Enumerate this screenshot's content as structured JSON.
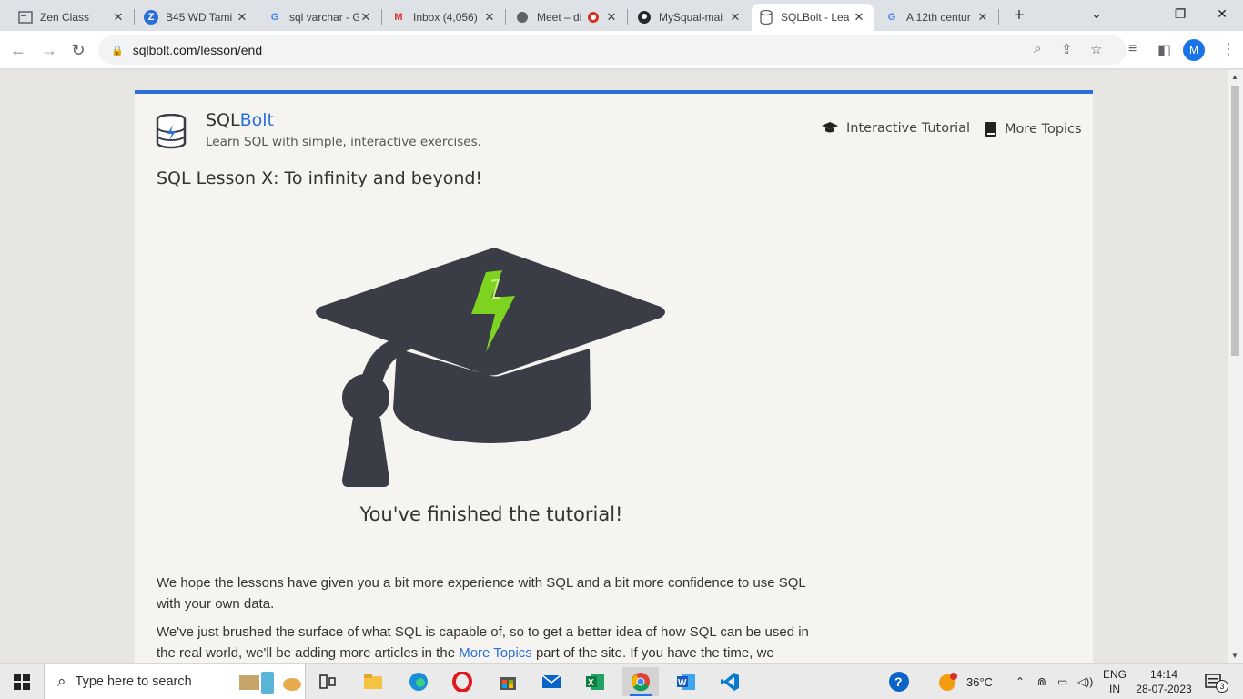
{
  "browser": {
    "tabs": [
      {
        "title": "Zen Class",
        "icon": "zen-class-icon",
        "active": false
      },
      {
        "title": "B45 WD Tami",
        "icon": "zoho-icon",
        "active": false
      },
      {
        "title": "sql varchar - G",
        "icon": "google-icon",
        "active": false
      },
      {
        "title": "Inbox (4,056)",
        "icon": "gmail-icon",
        "active": false
      },
      {
        "title": "Meet – di",
        "icon": "meet-icon",
        "active": false
      },
      {
        "title": "MySqual-mai",
        "icon": "github-icon",
        "active": false
      },
      {
        "title": "SQLBolt - Lea",
        "icon": "sqlbolt-icon",
        "active": true
      },
      {
        "title": "A 12th centur",
        "icon": "google-icon",
        "active": false
      }
    ],
    "new_tab_glyph": "+",
    "url": "sqlbolt.com/lesson/end",
    "profile_initial": "M"
  },
  "page": {
    "brand_part1": "SQL",
    "brand_part2": "Bolt",
    "tagline": "Learn SQL with simple, interactive exercises.",
    "nav": {
      "interactive_tutorial": "Interactive Tutorial",
      "more_topics": "More Topics"
    },
    "lesson_title": "SQL Lesson X: To infinity and beyond!",
    "finished_text": "You've finished the tutorial!",
    "paragraph1": "We hope the lessons have given you a bit more experience with SQL and a bit more confidence to use SQL with your own data.",
    "paragraph2_before": "We've just brushed the surface of what SQL is capable of, so to get a better idea of how SQL can be used in the real world, we'll be adding more articles in the ",
    "paragraph2_link": "More Topics",
    "paragraph2_after": " part of the site. If you have the time, we",
    "colors": {
      "accent": "#2d6fd5",
      "cap": "#3a3d45",
      "bolt": "#7ed321"
    }
  },
  "taskbar": {
    "search_placeholder": "Type here to search",
    "weather": "36°C",
    "lang_line1": "ENG",
    "lang_line2": "IN",
    "time": "14:14",
    "date": "28-07-2023",
    "notification_count": "3"
  }
}
